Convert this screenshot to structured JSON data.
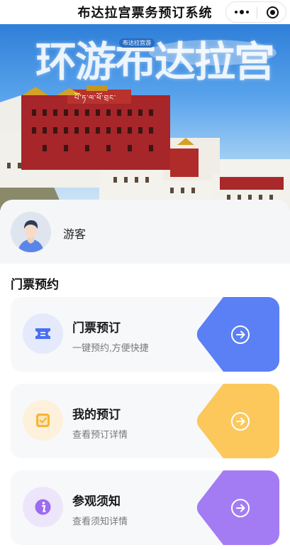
{
  "nav": {
    "title": "布达拉宫票务预订系统",
    "more_icon": "more-dots-icon",
    "close_icon": "target-circle-icon"
  },
  "banner": {
    "title": "环游布达拉宫",
    "tag": "布达拉宫游",
    "sub": "པོ་ཏ་ལ་ཕོ་བྲང་"
  },
  "user": {
    "name": "游客",
    "avatar_icon": "user-avatar-icon"
  },
  "section": {
    "title": "门票预约"
  },
  "cards": [
    {
      "title": "门票预订",
      "subtitle": "一键预约,方便快捷",
      "icon": "ticket-icon",
      "color": "#5b7ff5",
      "icon_bg": "#e4eafc"
    },
    {
      "title": "我的预订",
      "subtitle": "查看预订详情",
      "icon": "checklist-icon",
      "color": "#fcc85c",
      "icon_bg": "#fdf1dc"
    },
    {
      "title": "参观须知",
      "subtitle": "查看须知详情",
      "icon": "info-icon",
      "color": "#a37cf4",
      "icon_bg": "#ede6fb"
    }
  ]
}
